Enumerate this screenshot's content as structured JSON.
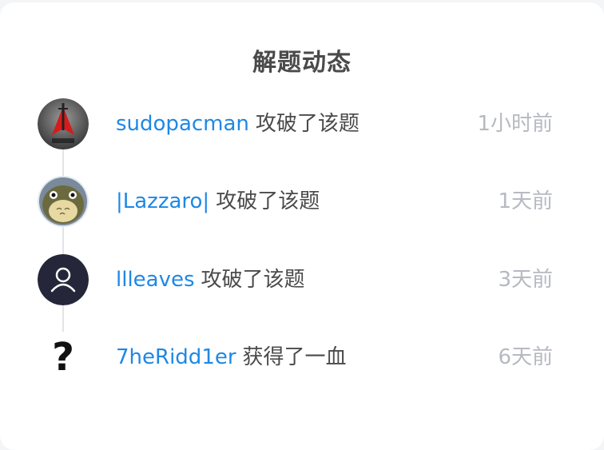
{
  "header": {
    "title": "解题动态"
  },
  "feed": [
    {
      "user": "sudopacman",
      "action": "攻破了该题",
      "time": "1小时前",
      "avatar": "blackarch-logo"
    },
    {
      "user": "|Lazzaro|",
      "action": "攻破了该题",
      "time": "1天前",
      "avatar": "totoro-image"
    },
    {
      "user": "llleaves",
      "action": "攻破了该题",
      "time": "3天前",
      "avatar": "default-user-icon"
    },
    {
      "user": "7heRidd1er",
      "action": "获得了一血",
      "time": "6天前",
      "avatar": "question-mark-icon"
    }
  ],
  "colors": {
    "user_link": "#1e88e5",
    "time": "#b7b9c2",
    "text": "#4a4a4a"
  }
}
